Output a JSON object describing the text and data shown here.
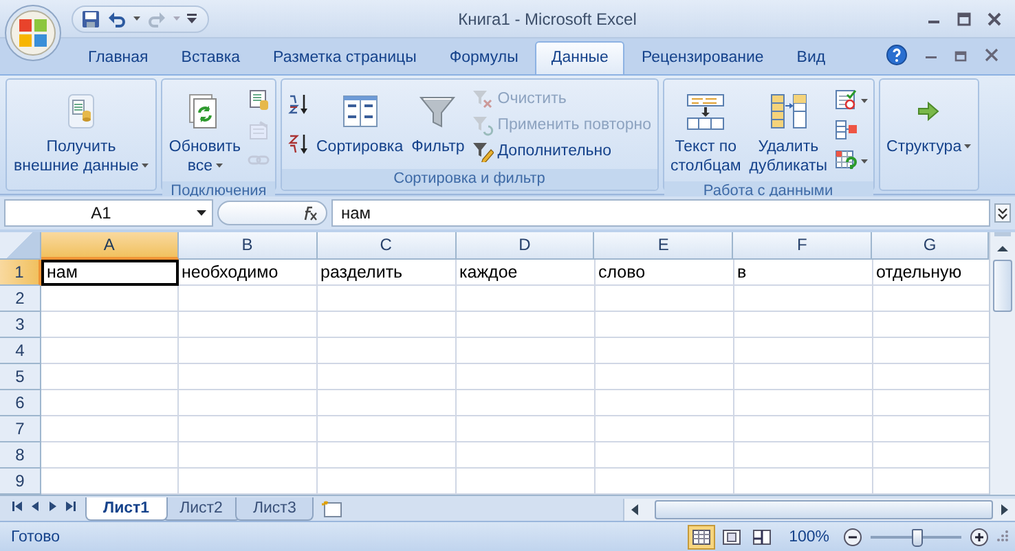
{
  "window": {
    "title": "Книга1 - Microsoft Excel"
  },
  "tabs": [
    {
      "label": "Главная",
      "selected": false
    },
    {
      "label": "Вставка",
      "selected": false
    },
    {
      "label": "Разметка страницы",
      "selected": false
    },
    {
      "label": "Формулы",
      "selected": false
    },
    {
      "label": "Данные",
      "selected": true
    },
    {
      "label": "Рецензирование",
      "selected": false
    },
    {
      "label": "Вид",
      "selected": false
    }
  ],
  "ribbon": {
    "groups": [
      {
        "items": [
          {
            "kind": "large",
            "label": "Получить\nвнешние данные",
            "dropdown": true,
            "disabled": false
          }
        ]
      },
      {
        "label": "Подключения",
        "items": [
          {
            "kind": "large",
            "label": "Обновить\nвсе",
            "dropdown": true,
            "disabled": false
          },
          {
            "kind": "icon",
            "disabled": false
          },
          {
            "kind": "icon",
            "disabled": true
          },
          {
            "kind": "icon",
            "disabled": true
          }
        ]
      },
      {
        "label": "Сортировка и фильтр",
        "items": [
          {
            "kind": "icon",
            "disabled": false
          },
          {
            "kind": "icon",
            "disabled": false
          },
          {
            "kind": "large",
            "label": "Сортировка",
            "disabled": false
          },
          {
            "kind": "large",
            "label": "Фильтр",
            "disabled": false
          },
          {
            "kind": "small",
            "label": "Очистить",
            "disabled": true
          },
          {
            "kind": "small",
            "label": "Применить повторно",
            "disabled": true
          },
          {
            "kind": "small",
            "label": "Дополнительно",
            "disabled": false
          }
        ]
      },
      {
        "label": "Работа с данными",
        "items": [
          {
            "kind": "large",
            "label": "Текст по\nстолбцам",
            "disabled": false
          },
          {
            "kind": "large",
            "label": "Удалить\nдубликаты",
            "disabled": false
          },
          {
            "kind": "icon",
            "dropdown": true,
            "disabled": false
          },
          {
            "kind": "icon",
            "disabled": false
          },
          {
            "kind": "icon",
            "dropdown": true,
            "disabled": false
          }
        ]
      },
      {
        "items": [
          {
            "kind": "large",
            "label": "Структура",
            "dropdown": true,
            "disabled": false
          }
        ]
      }
    ]
  },
  "formula_bar": {
    "name_box": "A1",
    "value": "нам"
  },
  "sheet": {
    "columns": [
      {
        "label": "A",
        "selected": true
      },
      {
        "label": "B",
        "selected": false
      },
      {
        "label": "C",
        "selected": false
      },
      {
        "label": "D",
        "selected": false
      },
      {
        "label": "E",
        "selected": false
      },
      {
        "label": "F",
        "selected": false
      },
      {
        "label": "G",
        "selected": false
      }
    ],
    "rows": [
      {
        "label": "1",
        "selected": true,
        "cells": [
          {
            "text": "нам",
            "selected": true
          },
          {
            "text": "необходимо",
            "selected": false
          },
          {
            "text": "разделить",
            "selected": false
          },
          {
            "text": "каждое",
            "selected": false
          },
          {
            "text": "слово",
            "selected": false
          },
          {
            "text": "в",
            "selected": false
          },
          {
            "text": "отдельную",
            "selected": false
          }
        ]
      },
      {
        "label": "2",
        "selected": false
      },
      {
        "label": "3",
        "selected": false
      },
      {
        "label": "4",
        "selected": false
      },
      {
        "label": "5",
        "selected": false
      },
      {
        "label": "6",
        "selected": false
      },
      {
        "label": "7",
        "selected": false
      },
      {
        "label": "8",
        "selected": false
      },
      {
        "label": "9",
        "selected": false
      }
    ]
  },
  "sheet_tabs": [
    {
      "label": "Лист1",
      "selected": true
    },
    {
      "label": "Лист2",
      "selected": false
    },
    {
      "label": "Лист3",
      "selected": false
    }
  ],
  "status_bar": {
    "status": "Готово",
    "views": [
      {
        "selected": true
      },
      {
        "selected": false
      },
      {
        "selected": false
      }
    ],
    "zoom": "100%",
    "zoom_slider": {
      "level": 0.5
    }
  }
}
